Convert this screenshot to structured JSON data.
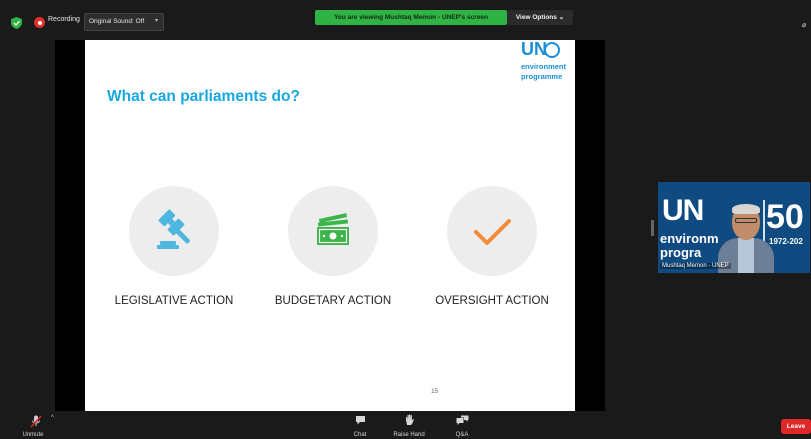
{
  "topbar": {
    "recording_label": "Recording",
    "original_sound_label": "Original Sound: Off",
    "original_sound_caret": "▾",
    "share_banner": "You are viewing Mushtaq Memon - UNEP's screen",
    "view_options_label": "View Options ⌄",
    "right_glyph": "⌀"
  },
  "slide": {
    "title": "What can parliaments do?",
    "logo": {
      "un": "UN",
      "line1": "environment",
      "line2": "programme"
    },
    "actions": [
      {
        "label": "LEGISLATIVE ACTION",
        "icon": "gavel-icon"
      },
      {
        "label": "BUDGETARY ACTION",
        "icon": "money-icon"
      },
      {
        "label": "OVERSIGHT ACTION",
        "icon": "checkmark-icon"
      }
    ],
    "page_number": "15"
  },
  "video": {
    "logo_un": "UN",
    "logo_env": "environm",
    "logo_prog": "progra",
    "logo_50": "50",
    "logo_years": "1972-202",
    "participant_name": "Mushtaq Memon - UNEP"
  },
  "toolbar": {
    "unmute_label": "Unmute",
    "chat_label": "Chat",
    "raise_hand_label": "Raise Hand",
    "qa_label": "Q&A",
    "leave_label": "Leave"
  },
  "colors": {
    "accent_title": "#17a8e2",
    "icon_blue": "#4fb6e0",
    "icon_green": "#3bb54a",
    "icon_orange": "#f08c3a",
    "banner_green": "#2fb344",
    "leave_red": "#e02828"
  }
}
